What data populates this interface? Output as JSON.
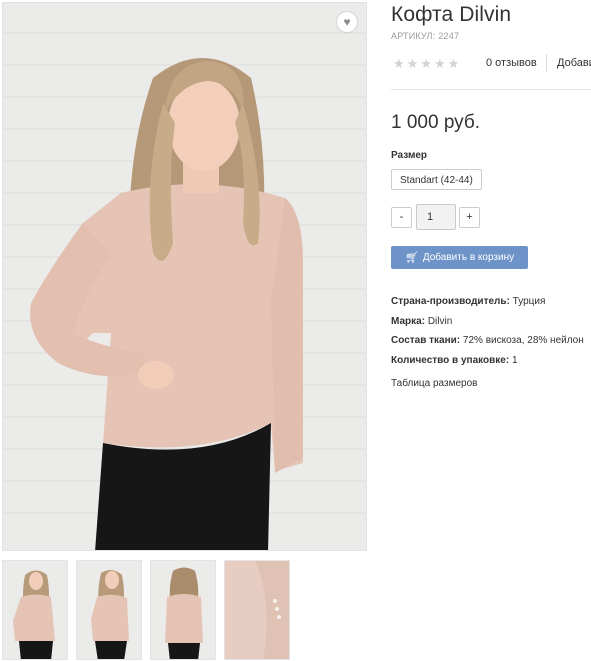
{
  "product": {
    "title": "Кофта Dilvin",
    "sku_label": "АРТИКУЛ:",
    "sku_value": "2247",
    "reviews": "0 отзывов",
    "add_review": "Добави",
    "price": "1 000 руб.",
    "rating_stars": "★★★★★",
    "rating_value": 0
  },
  "options": {
    "size_label": "Размер",
    "size_value": "Standart (42-44)"
  },
  "quantity": {
    "minus": "-",
    "plus": "+",
    "value": "1"
  },
  "cart_button": {
    "label": "Добавить в корзину",
    "icon": "cart-icon"
  },
  "specs": [
    {
      "label": "Страна-производитель:",
      "value": "Турция"
    },
    {
      "label": "Марка:",
      "value": "Dilvin"
    },
    {
      "label": "Состав ткани:",
      "value": "72% вискоза, 28% нейлон"
    },
    {
      "label": "Количество в упаковке:",
      "value": "1"
    }
  ],
  "size_table_link": "Таблица размеров",
  "icons": {
    "wishlist": "heart-icon",
    "cart": "cart-icon",
    "rating": "star-icon"
  },
  "colors": {
    "accent": "#6d93c9",
    "sweater": "#e6c4b5",
    "pants": "#161616",
    "wall": "#ebebea"
  }
}
